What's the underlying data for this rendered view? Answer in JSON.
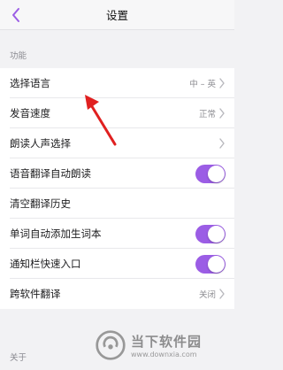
{
  "navbar": {
    "title": "设置"
  },
  "sections": {
    "features": "功能",
    "about": "关于"
  },
  "rows": [
    {
      "label": "选择语言",
      "value": "中 – 英",
      "type": "chevron"
    },
    {
      "label": "发音速度",
      "value": "正常",
      "type": "chevron"
    },
    {
      "label": "朗读人声选择",
      "value": "",
      "type": "chevron"
    },
    {
      "label": "语音翻译自动朗读",
      "value": "",
      "type": "toggle",
      "on": true
    },
    {
      "label": "清空翻译历史",
      "value": "",
      "type": "none"
    },
    {
      "label": "单词自动添加生词本",
      "value": "",
      "type": "toggle",
      "on": true
    },
    {
      "label": "通知栏快速入口",
      "value": "",
      "type": "toggle",
      "on": true
    },
    {
      "label": "跨软件翻译",
      "value": "关闭",
      "type": "chevron"
    }
  ],
  "watermark": {
    "title": "当下软件园",
    "url": "www.downxia.com"
  },
  "colors": {
    "accent": "#9b5de5",
    "arrow": "#e02020",
    "background": "#f2f2f4"
  },
  "icons": {
    "back": "chevron-left-icon",
    "row_chevron": "chevron-right-icon"
  }
}
